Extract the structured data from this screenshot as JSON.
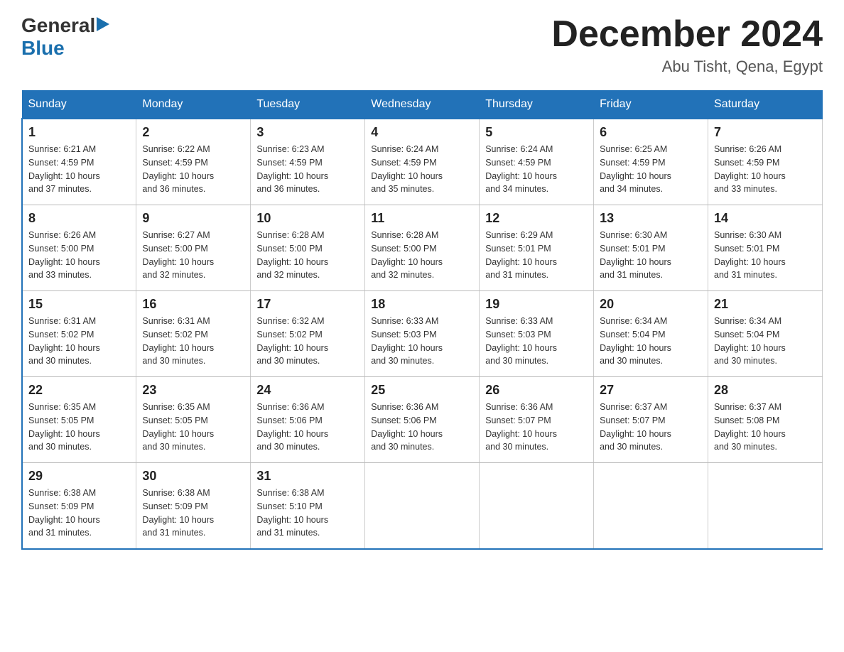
{
  "header": {
    "logo_general": "General",
    "logo_blue": "Blue",
    "title": "December 2024",
    "subtitle": "Abu Tisht, Qena, Egypt"
  },
  "days_of_week": [
    "Sunday",
    "Monday",
    "Tuesday",
    "Wednesday",
    "Thursday",
    "Friday",
    "Saturday"
  ],
  "weeks": [
    [
      {
        "day": "1",
        "sunrise": "6:21 AM",
        "sunset": "4:59 PM",
        "daylight": "10 hours and 37 minutes."
      },
      {
        "day": "2",
        "sunrise": "6:22 AM",
        "sunset": "4:59 PM",
        "daylight": "10 hours and 36 minutes."
      },
      {
        "day": "3",
        "sunrise": "6:23 AM",
        "sunset": "4:59 PM",
        "daylight": "10 hours and 36 minutes."
      },
      {
        "day": "4",
        "sunrise": "6:24 AM",
        "sunset": "4:59 PM",
        "daylight": "10 hours and 35 minutes."
      },
      {
        "day": "5",
        "sunrise": "6:24 AM",
        "sunset": "4:59 PM",
        "daylight": "10 hours and 34 minutes."
      },
      {
        "day": "6",
        "sunrise": "6:25 AM",
        "sunset": "4:59 PM",
        "daylight": "10 hours and 34 minutes."
      },
      {
        "day": "7",
        "sunrise": "6:26 AM",
        "sunset": "4:59 PM",
        "daylight": "10 hours and 33 minutes."
      }
    ],
    [
      {
        "day": "8",
        "sunrise": "6:26 AM",
        "sunset": "5:00 PM",
        "daylight": "10 hours and 33 minutes."
      },
      {
        "day": "9",
        "sunrise": "6:27 AM",
        "sunset": "5:00 PM",
        "daylight": "10 hours and 32 minutes."
      },
      {
        "day": "10",
        "sunrise": "6:28 AM",
        "sunset": "5:00 PM",
        "daylight": "10 hours and 32 minutes."
      },
      {
        "day": "11",
        "sunrise": "6:28 AM",
        "sunset": "5:00 PM",
        "daylight": "10 hours and 32 minutes."
      },
      {
        "day": "12",
        "sunrise": "6:29 AM",
        "sunset": "5:01 PM",
        "daylight": "10 hours and 31 minutes."
      },
      {
        "day": "13",
        "sunrise": "6:30 AM",
        "sunset": "5:01 PM",
        "daylight": "10 hours and 31 minutes."
      },
      {
        "day": "14",
        "sunrise": "6:30 AM",
        "sunset": "5:01 PM",
        "daylight": "10 hours and 31 minutes."
      }
    ],
    [
      {
        "day": "15",
        "sunrise": "6:31 AM",
        "sunset": "5:02 PM",
        "daylight": "10 hours and 30 minutes."
      },
      {
        "day": "16",
        "sunrise": "6:31 AM",
        "sunset": "5:02 PM",
        "daylight": "10 hours and 30 minutes."
      },
      {
        "day": "17",
        "sunrise": "6:32 AM",
        "sunset": "5:02 PM",
        "daylight": "10 hours and 30 minutes."
      },
      {
        "day": "18",
        "sunrise": "6:33 AM",
        "sunset": "5:03 PM",
        "daylight": "10 hours and 30 minutes."
      },
      {
        "day": "19",
        "sunrise": "6:33 AM",
        "sunset": "5:03 PM",
        "daylight": "10 hours and 30 minutes."
      },
      {
        "day": "20",
        "sunrise": "6:34 AM",
        "sunset": "5:04 PM",
        "daylight": "10 hours and 30 minutes."
      },
      {
        "day": "21",
        "sunrise": "6:34 AM",
        "sunset": "5:04 PM",
        "daylight": "10 hours and 30 minutes."
      }
    ],
    [
      {
        "day": "22",
        "sunrise": "6:35 AM",
        "sunset": "5:05 PM",
        "daylight": "10 hours and 30 minutes."
      },
      {
        "day": "23",
        "sunrise": "6:35 AM",
        "sunset": "5:05 PM",
        "daylight": "10 hours and 30 minutes."
      },
      {
        "day": "24",
        "sunrise": "6:36 AM",
        "sunset": "5:06 PM",
        "daylight": "10 hours and 30 minutes."
      },
      {
        "day": "25",
        "sunrise": "6:36 AM",
        "sunset": "5:06 PM",
        "daylight": "10 hours and 30 minutes."
      },
      {
        "day": "26",
        "sunrise": "6:36 AM",
        "sunset": "5:07 PM",
        "daylight": "10 hours and 30 minutes."
      },
      {
        "day": "27",
        "sunrise": "6:37 AM",
        "sunset": "5:07 PM",
        "daylight": "10 hours and 30 minutes."
      },
      {
        "day": "28",
        "sunrise": "6:37 AM",
        "sunset": "5:08 PM",
        "daylight": "10 hours and 30 minutes."
      }
    ],
    [
      {
        "day": "29",
        "sunrise": "6:38 AM",
        "sunset": "5:09 PM",
        "daylight": "10 hours and 31 minutes."
      },
      {
        "day": "30",
        "sunrise": "6:38 AM",
        "sunset": "5:09 PM",
        "daylight": "10 hours and 31 minutes."
      },
      {
        "day": "31",
        "sunrise": "6:38 AM",
        "sunset": "5:10 PM",
        "daylight": "10 hours and 31 minutes."
      },
      null,
      null,
      null,
      null
    ]
  ],
  "labels": {
    "sunrise_prefix": "Sunrise: ",
    "sunset_prefix": "Sunset: ",
    "daylight_prefix": "Daylight: "
  }
}
